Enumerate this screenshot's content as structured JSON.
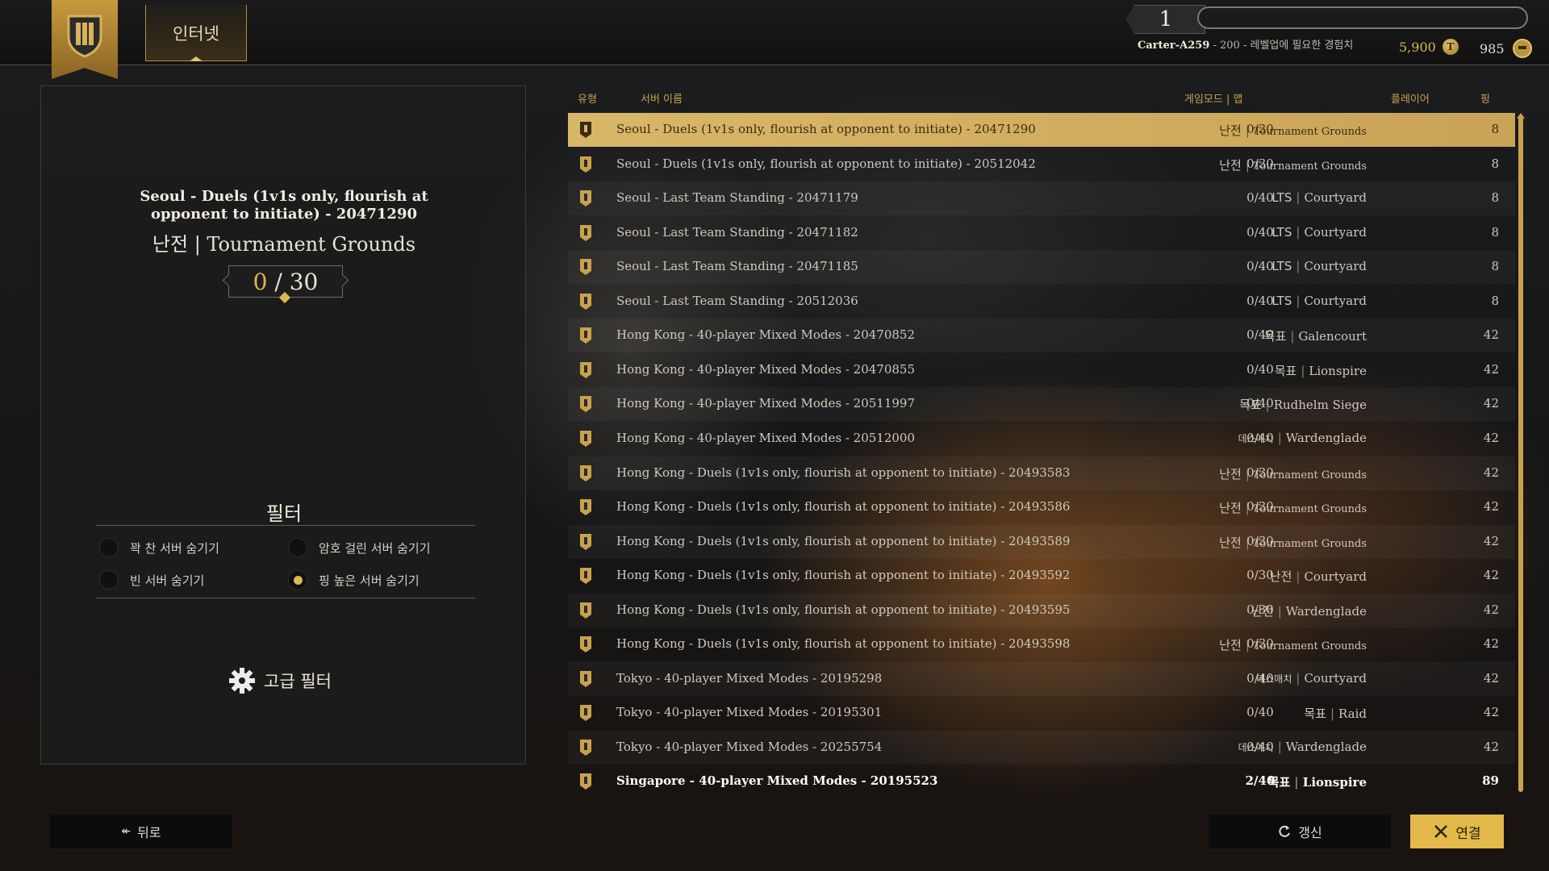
{
  "header": {
    "tab_label": "인터넷",
    "level": "1",
    "xp_progress": 0.0,
    "player_name": "Carter-A259",
    "player_suffix": " - 200 - 레벨업에 필요한 경험치",
    "gold": "5,900",
    "gold_icon": "T",
    "steel": "985",
    "accent_color": "#c9a14e"
  },
  "selected": {
    "name": "Seoul - Duels (1v1s only, flourish at opponent to initiate) - 20471290",
    "mode": "난전 | Tournament Grounds",
    "count_current": "0",
    "count_sep": " / ",
    "count_max": "30"
  },
  "filters": {
    "title": "필터",
    "options": [
      {
        "label": "꽉 찬 서버 숨기기",
        "checked": false
      },
      {
        "label": "암호 걸린 서버 숨기기",
        "checked": false
      },
      {
        "label": "빈 서버 숨기기",
        "checked": false
      },
      {
        "label": "핑 높은 서버 숨기기",
        "checked": true
      }
    ],
    "advanced_label": "고급 필터"
  },
  "columns": {
    "type": "유형",
    "name": "서버 이름",
    "mode": "게임모드 | 맵",
    "players": "플레이어",
    "ping": "핑"
  },
  "servers": [
    {
      "name": "Seoul - Duels (1v1s only, flourish at opponent to initiate) - 20471290",
      "mode": "난전",
      "map": "Tournament Grounds",
      "players": "0/30",
      "ping": "8"
    },
    {
      "name": "Seoul - Duels (1v1s only, flourish at opponent to initiate) - 20512042",
      "mode": "난전",
      "map": "Tournament Grounds",
      "players": "0/30",
      "ping": "8"
    },
    {
      "name": "Seoul - Last Team Standing - 20471179",
      "mode": "LTS",
      "map": "Courtyard",
      "players": "0/40",
      "ping": "8"
    },
    {
      "name": "Seoul - Last Team Standing - 20471182",
      "mode": "LTS",
      "map": "Courtyard",
      "players": "0/40",
      "ping": "8"
    },
    {
      "name": "Seoul - Last Team Standing - 20471185",
      "mode": "LTS",
      "map": "Courtyard",
      "players": "0/40",
      "ping": "8"
    },
    {
      "name": "Seoul - Last Team Standing - 20512036",
      "mode": "LTS",
      "map": "Courtyard",
      "players": "0/40",
      "ping": "8"
    },
    {
      "name": "Hong Kong - 40-player Mixed Modes - 20470852",
      "mode": "목표",
      "map": "Galencourt",
      "players": "0/40",
      "ping": "42"
    },
    {
      "name": "Hong Kong - 40-player Mixed Modes - 20470855",
      "mode": "목표",
      "map": "Lionspire",
      "players": "0/40",
      "ping": "42"
    },
    {
      "name": "Hong Kong - 40-player Mixed Modes - 20511997",
      "mode": "목표",
      "map": "Rudhelm Siege",
      "players": "0/40",
      "ping": "42"
    },
    {
      "name": "Hong Kong - 40-player Mixed Modes - 20512000",
      "mode": "데스매치",
      "map": "Wardenglade",
      "players": "0/40",
      "ping": "42"
    },
    {
      "name": "Hong Kong - Duels (1v1s only, flourish at opponent to initiate) - 20493583",
      "mode": "난전",
      "map": "Tournament Grounds",
      "players": "0/30",
      "ping": "42"
    },
    {
      "name": "Hong Kong - Duels (1v1s only, flourish at opponent to initiate) - 20493586",
      "mode": "난전",
      "map": "Tournament Grounds",
      "players": "0/30",
      "ping": "42"
    },
    {
      "name": "Hong Kong - Duels (1v1s only, flourish at opponent to initiate) - 20493589",
      "mode": "난전",
      "map": "Tournament Grounds",
      "players": "0/30",
      "ping": "42"
    },
    {
      "name": "Hong Kong - Duels (1v1s only, flourish at opponent to initiate) - 20493592",
      "mode": "난전",
      "map": "Courtyard",
      "players": "0/30",
      "ping": "42"
    },
    {
      "name": "Hong Kong - Duels (1v1s only, flourish at opponent to initiate) - 20493595",
      "mode": "난전",
      "map": "Wardenglade",
      "players": "0/30",
      "ping": "42"
    },
    {
      "name": "Hong Kong - Duels (1v1s only, flourish at opponent to initiate) - 20493598",
      "mode": "난전",
      "map": "Tournament Grounds",
      "players": "0/30",
      "ping": "42"
    },
    {
      "name": "Tokyo - 40-player Mixed Modes - 20195298",
      "mode": "데스매치",
      "map": "Courtyard",
      "players": "0/40",
      "ping": "42"
    },
    {
      "name": "Tokyo - 40-player Mixed Modes - 20195301",
      "mode": "목표",
      "map": "Raid",
      "players": "0/40",
      "ping": "42"
    },
    {
      "name": "Tokyo - 40-player Mixed Modes - 20255754",
      "mode": "데스매치",
      "map": "Wardenglade",
      "players": "0/40",
      "ping": "42"
    },
    {
      "name": "Singapore - 40-player Mixed Modes - 20195523",
      "mode": "목표",
      "map": "Lionspire",
      "players": "2/40",
      "ping": "89"
    }
  ],
  "footer": {
    "back_label": "뒤로",
    "refresh_label": "갱신",
    "connect_label": "연결"
  }
}
